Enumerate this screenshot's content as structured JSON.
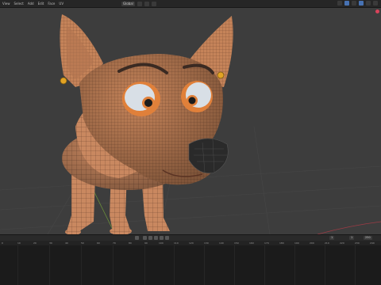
{
  "header": {
    "menu": [
      "View",
      "Select",
      "Add",
      "Edit",
      "Face",
      "UV"
    ],
    "orientation_label": "Global",
    "snap_icon": "magnet-icon",
    "proportional_icon": "proportional-icon"
  },
  "viewport": {
    "object": "cartoon-fox-model",
    "accent": "#d9435b"
  },
  "timeline": {
    "frame_start": "1",
    "frame_end": "250",
    "current_frame": "1",
    "ruler": [
      "0",
      "10",
      "20",
      "30",
      "40",
      "50",
      "60",
      "70",
      "80",
      "90",
      "100",
      "110",
      "120",
      "130",
      "140",
      "150",
      "160",
      "170",
      "180",
      "190",
      "200",
      "210",
      "220",
      "230",
      "240"
    ]
  },
  "colors": {
    "viewport_bg": "#3d3d3d",
    "skin": "#c98860",
    "wire": "#6b4430",
    "eye_ring": "#e0803a"
  }
}
